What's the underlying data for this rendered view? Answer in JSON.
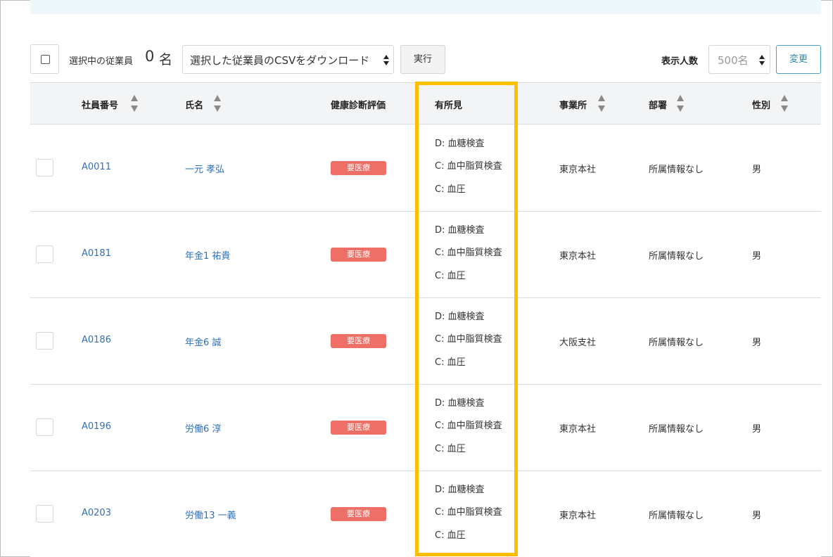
{
  "toolbar": {
    "selected_label": "選択中の従業員",
    "selected_count": "0",
    "selected_unit": "名",
    "action_select_value": "選択した従業員のCSVをダウンロード",
    "run_label": "実行",
    "display_count_label": "表示人数",
    "display_count_value": "500名",
    "change_label": "変更"
  },
  "table": {
    "headers": {
      "employee_id": "社員番号",
      "name": "氏名",
      "health_rating": "健康診断評価",
      "findings": "有所見",
      "office": "事業所",
      "department": "部署",
      "gender": "性別"
    },
    "rows": [
      {
        "employee_id": "A0011",
        "name": "一元 孝弘",
        "rating": "要医療",
        "findings": [
          "D: 血糖検査",
          "C: 血中脂質検査",
          "C: 血圧"
        ],
        "office": "東京本社",
        "department": "所属情報なし",
        "gender": "男"
      },
      {
        "employee_id": "A0181",
        "name": "年金1 祐貴",
        "rating": "要医療",
        "findings": [
          "D: 血糖検査",
          "C: 血中脂質検査",
          "C: 血圧"
        ],
        "office": "東京本社",
        "department": "所属情報なし",
        "gender": "男"
      },
      {
        "employee_id": "A0186",
        "name": "年金6 誠",
        "rating": "要医療",
        "findings": [
          "D: 血糖検査",
          "C: 血中脂質検査",
          "C: 血圧"
        ],
        "office": "大阪支社",
        "department": "所属情報なし",
        "gender": "男"
      },
      {
        "employee_id": "A0196",
        "name": "労働6 淳",
        "rating": "要医療",
        "findings": [
          "D: 血糖検査",
          "C: 血中脂質検査",
          "C: 血圧"
        ],
        "office": "東京本社",
        "department": "所属情報なし",
        "gender": "男"
      },
      {
        "employee_id": "A0203",
        "name": "労働13 一義",
        "rating": "要医療",
        "findings": [
          "D: 血糖検査",
          "C: 血中脂質検査",
          "C: 血圧"
        ],
        "office": "東京本社",
        "department": "所属情報なし",
        "gender": "男"
      }
    ]
  },
  "colors": {
    "highlight": "#ffbf00",
    "badge": "#ee6f66",
    "link": "#2f6fba",
    "accent": "#2b8aa6"
  }
}
